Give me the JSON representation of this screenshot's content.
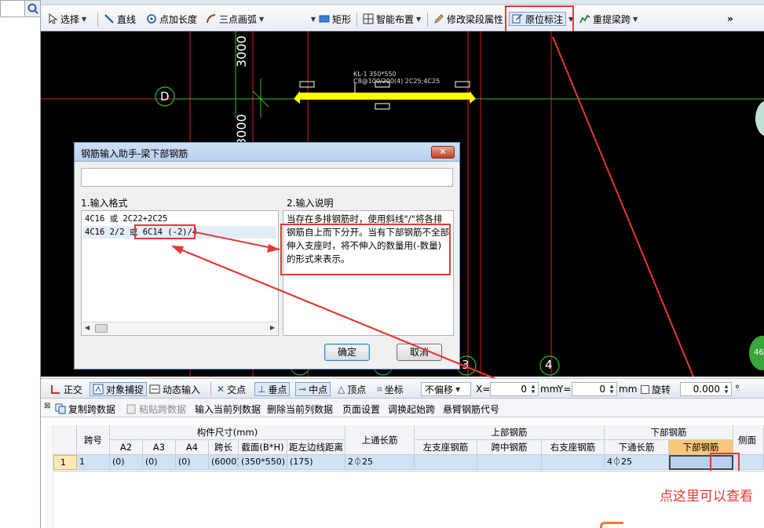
{
  "toolbar": {
    "select": "选择",
    "line": "直线",
    "point_length": "点加长度",
    "three_arc": "三点画弧",
    "rect": "矩形",
    "smart_layout": "智能布置",
    "modify_span": "修改梁段属性",
    "inplace_mark": "原位标注",
    "re_extract": "重提梁跨",
    "more": "»"
  },
  "canvas": {
    "dim_top": "3000",
    "dim_mid": "3000",
    "axis_d": "D",
    "axis_4": "4",
    "axis_3": "3",
    "beam_label_1": "KL-1 350*550",
    "beam_label_2": "C8@100/200(4) 2C25;4C25",
    "side_badge": "46"
  },
  "dialog": {
    "title": "钢筋输入助手-梁下部钢筋",
    "close": "✕",
    "input_value": "",
    "format_label": "1.输入格式",
    "desc_label": "2.输入说明",
    "formats": [
      "4C16 或 2C22+2C25",
      "4C16 2/2 或 6C14 (-2)/4"
    ],
    "description": "当存在多排钢筋时，使用斜线\"/\"将各排钢筋自上而下分开。当有下部钢筋不全部伸入支座时，将不伸入的数量用(-数量)的形式来表示。",
    "ok": "确定",
    "cancel": "取消"
  },
  "toolbar2": {
    "orthogonal": "正交",
    "snap": "对象捕捉",
    "dynamic_input": "动态输入",
    "intersection": "交点",
    "perpendicular": "垂点",
    "midpoint": "中点",
    "vertex": "顶点",
    "coordinate": "坐标",
    "offset_mode": "不偏移",
    "x_label": "X=",
    "x_value": "0",
    "y_label": "Y=",
    "y_value": "0",
    "unit": "mm",
    "rotate": "旋转",
    "rotate_value": "0.000",
    "degree": "°"
  },
  "toolbar3": {
    "copy_span": "复制跨数据",
    "paste_span": "粘贴跨数据",
    "input_col": "输入当前列数据",
    "delete_col": "删除当前列数据",
    "page_setup": "页面设置",
    "swap_start": "调换起始跨",
    "cantilever": "悬臂钢筋代号"
  },
  "table": {
    "headers": {
      "span_no": "跨号",
      "member_size": "构件尺寸(mm)",
      "a2": "A2",
      "a3": "A3",
      "a4": "A4",
      "span_len": "跨长",
      "section": "截面(B*H)",
      "dist_left": "距左边线距离",
      "top_through": "上通长筋",
      "top_rebar": "上部钢筋",
      "left_support": "左支座钢筋",
      "mid_span": "跨中钢筋",
      "right_support": "右支座钢筋",
      "bottom_rebar": "下部钢筋",
      "bottom_through": "下通长筋",
      "bottom_rebar_col": "下部钢筋",
      "side": "侧面"
    },
    "row": {
      "index": "1",
      "span": "1",
      "a2": "(0)",
      "a3": "(0)",
      "a4": "(0)",
      "span_len": "(6000)",
      "section": "(350*550)",
      "dist_left": "(175)",
      "top_through": "2⏀25",
      "left_support": "",
      "mid_span": "",
      "right_support": "",
      "bottom_through": "4⏀25",
      "bottom_rebar": ""
    }
  },
  "annotation": {
    "note": "点这里可以查看"
  }
}
